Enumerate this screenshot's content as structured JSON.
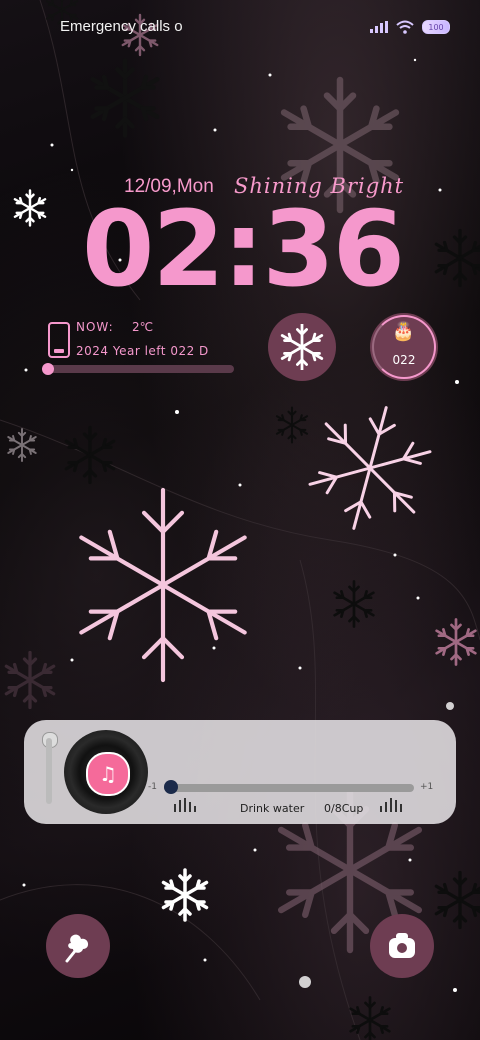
{
  "status_bar": {
    "carrier_text": "Emergency calls o",
    "battery_level": "100",
    "icons": [
      "signal-icon",
      "wifi-icon",
      "battery-icon"
    ]
  },
  "lockscreen": {
    "date": "12/09,Mon",
    "tagline": "Shining Bright",
    "time": "02:36",
    "weather_label": "NOW:",
    "weather_temp": "2℃",
    "year_left": "2024 Year left 022 D",
    "countdown_days": "022"
  },
  "music_widget": {
    "slider_min": "-1",
    "slider_max": "+1",
    "drink_label": "Drink water",
    "drink_count": "0/8Cup"
  },
  "shortcuts": {
    "left_icon": "cotton-candy-icon",
    "right_icon": "camera-icon"
  },
  "colors": {
    "accent_pink": "#f598cc",
    "widget_bg": "#6e3d52",
    "background": "#080608"
  }
}
